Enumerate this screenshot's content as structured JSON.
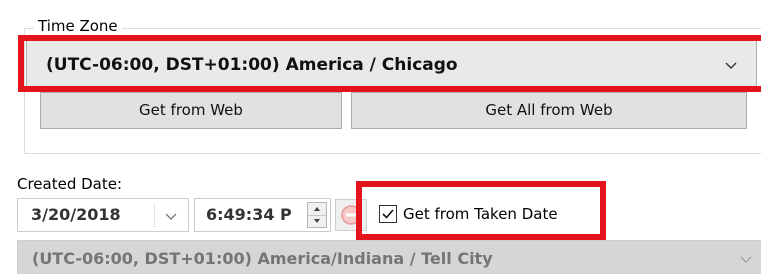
{
  "timezone_group": {
    "legend": "Time Zone",
    "selected": "(UTC-06:00, DST+01:00) America / Chicago",
    "get_from_web_label": "Get from Web",
    "get_all_from_web_label": "Get All from Web"
  },
  "created_date": {
    "label": "Created Date:",
    "date_value": "3/20/2018",
    "time_value": "6:49:34 P",
    "get_from_taken_label": "Get from Taken Date",
    "get_from_taken_checked": true,
    "timezone_value": "(UTC-06:00, DST+01:00) America/Indiana / Tell City",
    "timezone_enabled": false
  },
  "colors": {
    "highlight": "#e3141b",
    "button_face": "#e1e1e1",
    "disabled_combo": "#d6d6d6"
  },
  "icons": {
    "dropdown": "chevron-down-icon",
    "spinner_up": "caret-up-icon",
    "spinner_down": "caret-down-icon",
    "clear": "minus-circle-icon",
    "check": "checkmark-icon"
  }
}
